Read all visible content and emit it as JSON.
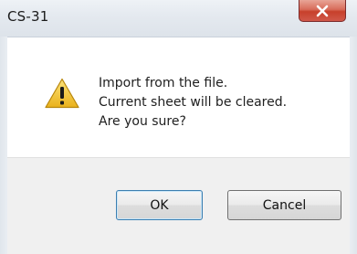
{
  "window": {
    "title": "CS-31",
    "close_icon": "close-icon"
  },
  "dialog": {
    "icon": "warning-icon",
    "message_lines": [
      "Import from the file.",
      "Current sheet will be cleared.",
      "Are you sure?"
    ]
  },
  "buttons": {
    "ok_label": "OK",
    "cancel_label": "Cancel"
  },
  "colors": {
    "close_button": "#c7402b",
    "warning_fill": "#f2c12e",
    "default_button_border": "#3c7fb1"
  }
}
